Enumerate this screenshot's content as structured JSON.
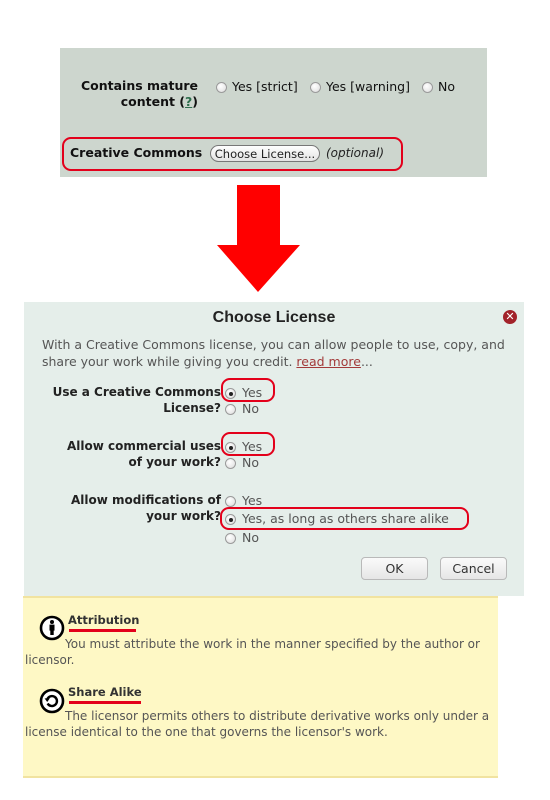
{
  "top_form": {
    "mature_label_line1": "Contains mature",
    "mature_label_line2": "content (",
    "mature_help_link": "?",
    "mature_label_close": ")",
    "mature_options": [
      {
        "label": "Yes [strict]",
        "checked": false
      },
      {
        "label": "Yes [warning]",
        "checked": false
      },
      {
        "label": "No",
        "checked": false
      }
    ],
    "cc_label": "Creative Commons",
    "choose_button": "Choose License...",
    "optional_note": "(optional)"
  },
  "arrow": {
    "icon": "down-arrow-icon",
    "color": "#ff0000"
  },
  "dialog": {
    "title": "Choose License",
    "close_icon": "close-icon",
    "intro": "With a Creative Commons license, you can allow people to use, copy, and share your work while giving you credit. ",
    "read_more": "read more",
    "ellipsis": "...",
    "questions": [
      {
        "label_line1": "Use a Creative Commons",
        "label_line2": "License?",
        "options": [
          {
            "label": "Yes",
            "checked": true
          },
          {
            "label": "No",
            "checked": false
          }
        ]
      },
      {
        "label_line1": "Allow commercial uses",
        "label_line2": "of your work?",
        "options": [
          {
            "label": "Yes",
            "checked": true
          },
          {
            "label": "No",
            "checked": false
          }
        ]
      },
      {
        "label_line1": "Allow modifications of",
        "label_line2": "your work?",
        "options": [
          {
            "label": "Yes",
            "checked": false
          },
          {
            "label": "Yes, as long as others share alike",
            "checked": true
          },
          {
            "label": "No",
            "checked": false
          }
        ]
      }
    ],
    "ok_button": "OK",
    "cancel_button": "Cancel"
  },
  "info": {
    "items": [
      {
        "icon": "attribution-icon",
        "title": "Attribution",
        "text": "You must attribute the work in the manner specified by the author or licensor."
      },
      {
        "icon": "share-alike-icon",
        "title": "Share Alike",
        "text": "The licensor permits others to distribute derivative works only under a license identical to the one that governs the licensor's work."
      }
    ]
  },
  "colors": {
    "highlight": "#e3001b",
    "arrow": "#ff0000",
    "close": "#a2222a",
    "info_bg": "#fef8c5",
    "dialog_bg": "#e5eeea",
    "form_bg": "#cdd6ce"
  }
}
